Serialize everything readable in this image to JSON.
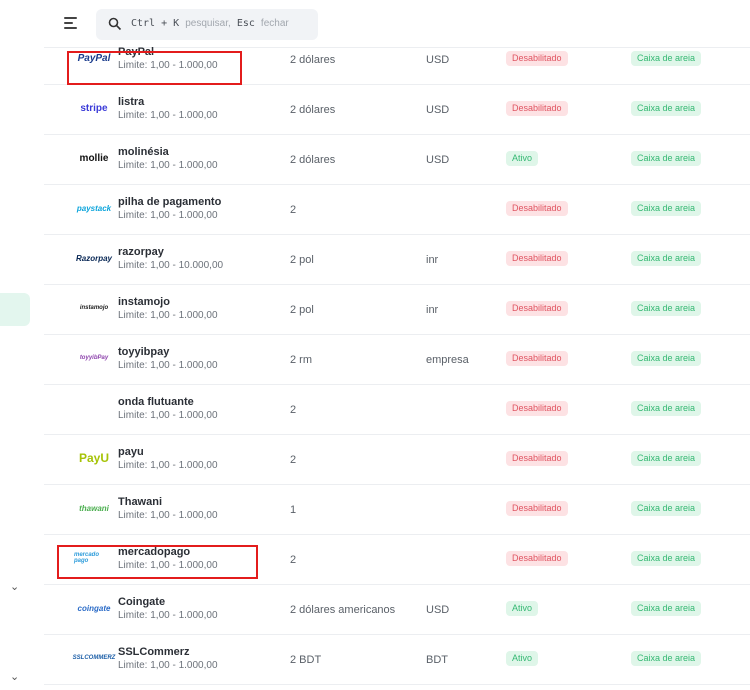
{
  "search": {
    "shortcut": "Ctrl + K",
    "placeholder_text": "pesquisar,",
    "close_key": "Esc",
    "close_text": "fechar"
  },
  "gateways": [
    {
      "logo": "PayPal",
      "logo_color": "#1a3b8c",
      "name": "PayPal",
      "limit": "Limite: 1,00 - 1.000,00",
      "fee": "2 dólares",
      "currency": "USD",
      "status": "Desabilitado",
      "status_on": false,
      "mode": "Caixa de areia"
    },
    {
      "logo": "stripe",
      "logo_color": "#3b3bd8",
      "name": "listra",
      "limit": "Limite: 1,00 - 1.000,00",
      "fee": "2 dólares",
      "currency": "USD",
      "status": "Desabilitado",
      "status_on": false,
      "mode": "Caixa de areia"
    },
    {
      "logo": "mollie",
      "logo_color": "#111111",
      "name": "molinésia",
      "limit": "Limite: 1,00 - 1.000,00",
      "fee": "2 dólares",
      "currency": "USD",
      "status": "Ativo",
      "status_on": true,
      "mode": "Caixa de areia"
    },
    {
      "logo": "paystack",
      "logo_color": "#0ba4db",
      "name": "pilha de pagamento",
      "limit": "Limite: 1,00 - 1.000,00",
      "fee": "2",
      "currency": "",
      "status": "Desabilitado",
      "status_on": false,
      "mode": "Caixa de areia"
    },
    {
      "logo": "Razorpay",
      "logo_color": "#072654",
      "name": "razorpay",
      "limit": "Limite: 1,00 - 10.000,00",
      "fee": "2 pol",
      "currency": "inr",
      "status": "Desabilitado",
      "status_on": false,
      "mode": "Caixa de areia"
    },
    {
      "logo": "instamojo",
      "logo_color": "#222222",
      "name": "instamojo",
      "limit": "Limite: 1,00 - 1.000,00",
      "fee": "2 pol",
      "currency": "inr",
      "status": "Desabilitado",
      "status_on": false,
      "mode": "Caixa de areia"
    },
    {
      "logo": "toyyibPay",
      "logo_color": "#8e44ad",
      "name": "toyyibpay",
      "limit": "Limite: 1,00 - 1.000,00",
      "fee": "2 rm",
      "currency": "empresa",
      "status": "Desabilitado",
      "status_on": false,
      "mode": "Caixa de areia"
    },
    {
      "logo": "",
      "logo_color": "#ffffff",
      "name": "onda flutuante",
      "limit": "Limite: 1,00 - 1.000,00",
      "fee": "2",
      "currency": "",
      "status": "Desabilitado",
      "status_on": false,
      "mode": "Caixa de areia"
    },
    {
      "logo": "PayU",
      "logo_color": "#a6c307",
      "name": "payu",
      "limit": "Limite: 1,00 - 1.000,00",
      "fee": "2",
      "currency": "",
      "status": "Desabilitado",
      "status_on": false,
      "mode": "Caixa de areia"
    },
    {
      "logo": "thawani",
      "logo_color": "#4caf50",
      "name": "Thawani",
      "limit": "Limite: 1,00 - 1.000,00",
      "fee": "1",
      "currency": "",
      "status": "Desabilitado",
      "status_on": false,
      "mode": "Caixa de areia"
    },
    {
      "logo": "mercado pago",
      "logo_color": "#2d9cdb",
      "name": "mercadopago",
      "limit": "Limite: 1,00 - 1.000,00",
      "fee": "2",
      "currency": "",
      "status": "Desabilitado",
      "status_on": false,
      "mode": "Caixa de areia"
    },
    {
      "logo": "coingate",
      "logo_color": "#2a6bc7",
      "name": "Coingate",
      "limit": "Limite: 1,00 - 1.000,00",
      "fee": "2 dólares americanos",
      "currency": "USD",
      "status": "Ativo",
      "status_on": true,
      "mode": "Caixa de areia"
    },
    {
      "logo": "SSLCOMMERZ",
      "logo_color": "#1d5fa8",
      "name": "SSLCommerz",
      "limit": "Limite: 1,00 - 1.000,00",
      "fee": "2 BDT",
      "currency": "BDT",
      "status": "Ativo",
      "status_on": true,
      "mode": "Caixa de areia"
    }
  ]
}
